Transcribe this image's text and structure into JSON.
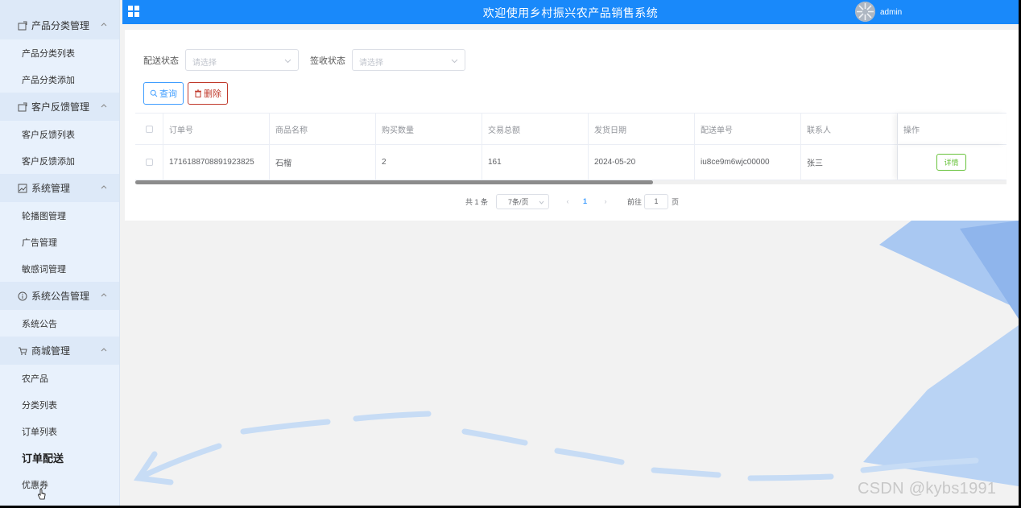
{
  "header": {
    "title": "欢迎使用乡村振兴农产品销售系统",
    "user": "admin"
  },
  "sidebar": {
    "groups": [
      {
        "label": "产品分类管理",
        "icon": "folder-icon",
        "items": [
          "产品分类列表",
          "产品分类添加"
        ]
      },
      {
        "label": "客户反馈管理",
        "icon": "folder-icon",
        "items": [
          "客户反馈列表",
          "客户反馈添加"
        ]
      },
      {
        "label": "系统管理",
        "icon": "picture-icon",
        "items": [
          "轮播图管理",
          "广告管理",
          "敏感词管理"
        ]
      },
      {
        "label": "系统公告管理",
        "icon": "info-icon",
        "items": [
          "系统公告"
        ]
      },
      {
        "label": "商城管理",
        "icon": "cart-icon",
        "items": [
          "农产品",
          "分类列表",
          "订单列表",
          "订单配送",
          "优惠券"
        ]
      }
    ],
    "active_item": "订单配送"
  },
  "filters": {
    "delivery_label": "配送状态",
    "delivery_placeholder": "请选择",
    "receipt_label": "签收状态",
    "receipt_placeholder": "请选择"
  },
  "buttons": {
    "query": "查询",
    "delete": "删除"
  },
  "table": {
    "columns": [
      "订单号",
      "商品名称",
      "购买数量",
      "交易总额",
      "发货日期",
      "配送单号",
      "联系人",
      "操作"
    ],
    "rows": [
      {
        "order_no": "1716188708891923825",
        "product": "石榴",
        "quantity": "2",
        "total": "161",
        "ship_date": "2024-05-20",
        "tracking_no": "iu8ce9m6wjc00000",
        "contact": "张三",
        "action": "详情"
      }
    ]
  },
  "pagination": {
    "total_text": "共 1 条",
    "page_size": "7条/页",
    "current_page": "1",
    "goto_label": "前往",
    "goto_value": "1",
    "page_unit": "页"
  },
  "watermark": "CSDN @kybs1991",
  "colors": {
    "header": "#1989fa",
    "sidebar": "#e8f1fc",
    "primary": "#409eff",
    "danger": "#c0392b",
    "success": "#67c23a"
  }
}
